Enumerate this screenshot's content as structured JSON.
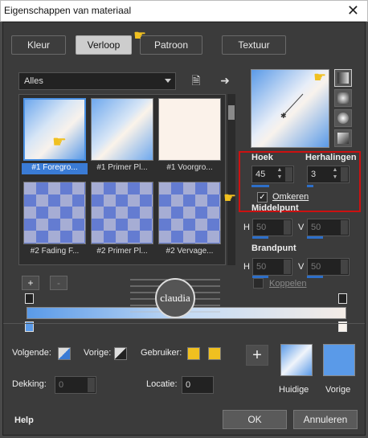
{
  "window": {
    "title": "Eigenschappen van materiaal",
    "close": "✕"
  },
  "tabs": [
    {
      "label": "Kleur"
    },
    {
      "label": "Verloop"
    },
    {
      "label": "Patroon"
    },
    {
      "label": "Textuur"
    }
  ],
  "library": {
    "category": "Alles",
    "thumbnails": [
      {
        "label": "#1 Foregro..."
      },
      {
        "label": "#1 Primer Pl..."
      },
      {
        "label": "#1 Voorgro..."
      },
      {
        "label": "#2 Fading F..."
      },
      {
        "label": "#2 Primer Pl..."
      },
      {
        "label": "#2 Vervage..."
      }
    ],
    "add_label": "+",
    "remove_label": "-"
  },
  "settings": {
    "angle_label": "Hoek",
    "angle_value": "45",
    "repeats_label": "Herhalingen",
    "repeats_value": "3",
    "invert_label": "Omkeren",
    "invert_checked": true,
    "center_label": "Middelpunt",
    "center_h_label": "H",
    "center_h_value": "50",
    "center_v_label": "V",
    "center_v_value": "50",
    "focal_label": "Brandpunt",
    "focal_h_label": "H",
    "focal_h_value": "50",
    "focal_v_label": "V",
    "focal_v_value": "50",
    "link_label": "Koppelen"
  },
  "editor": {
    "next_label": "Volgende:",
    "prev_label": "Vorige:",
    "user_label": "Gebruiker:",
    "opacity_label": "Dekking:",
    "opacity_value": "0",
    "location_label": "Locatie:",
    "location_value": "0",
    "add_label": "+"
  },
  "swatches": {
    "current_label": "Huidige",
    "previous_label": "Vorige"
  },
  "footer": {
    "help_label": "Help",
    "ok_label": "OK",
    "cancel_label": "Annuleren"
  },
  "watermark": {
    "text": "claudia"
  },
  "colors": {
    "accent": "#3a7bd5",
    "gradient_blue": "#5a9ae8",
    "gradient_cream": "#f8f2ec",
    "highlight_red": "#cc1111",
    "user_yellow": "#f0c020"
  }
}
